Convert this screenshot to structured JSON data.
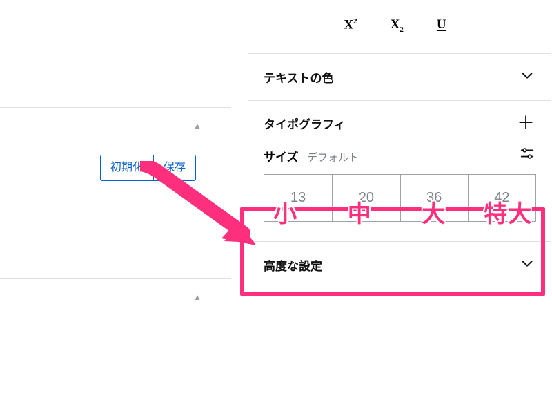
{
  "left": {
    "reset_label": "初期化",
    "save_label": "保存"
  },
  "sidebar": {
    "formats": {
      "superscript": "X",
      "subscript": "X",
      "underline": "U"
    },
    "panels": {
      "text_color": "テキストの色",
      "typography": "タイポグラフィ",
      "advanced": "高度な設定"
    },
    "size": {
      "label": "サイズ",
      "default": "デフォルト",
      "options": [
        "13",
        "20",
        "36",
        "42"
      ]
    }
  },
  "annotation": {
    "labels": [
      "小",
      "中",
      "大",
      "特大"
    ]
  }
}
